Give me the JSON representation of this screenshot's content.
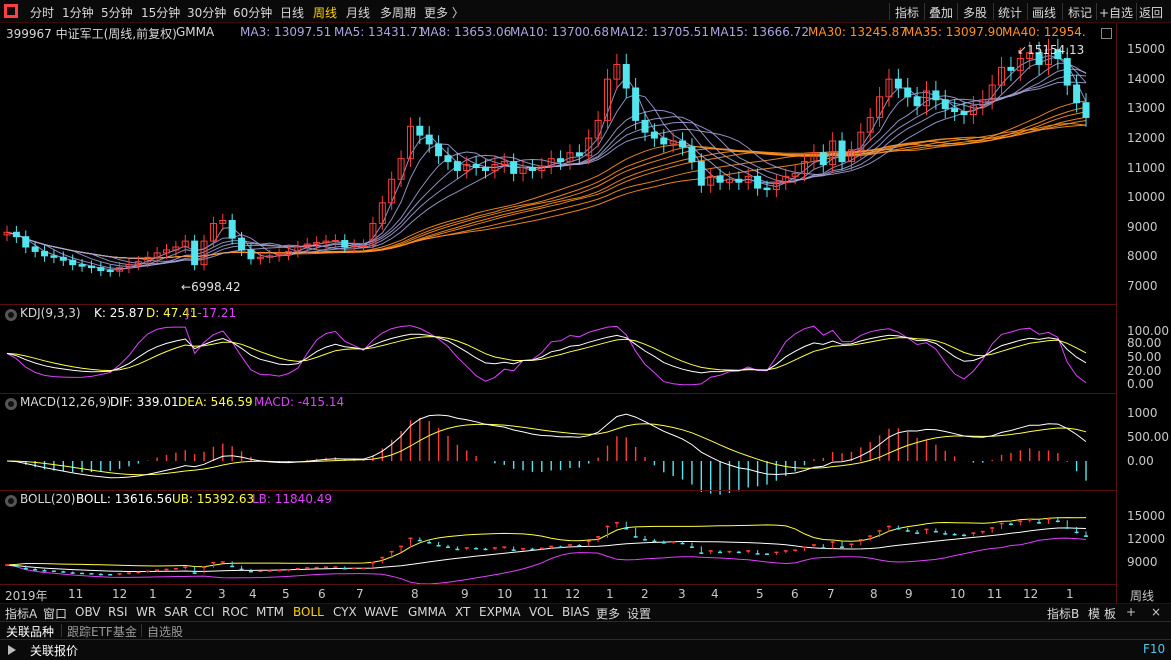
{
  "timeframes": [
    "分时",
    "1分钟",
    "5分钟",
    "15分钟",
    "30分钟",
    "60分钟",
    "日线",
    "周线",
    "月线",
    "多周期",
    "更多 〉"
  ],
  "active_timeframe": "周线",
  "toolbar": [
    "指标",
    "叠加",
    "多股",
    "统计",
    "画线",
    "标记",
    "+自选",
    "返回"
  ],
  "main": {
    "symbol": "399967 中证军工(周线,前复权)",
    "indicator": "GMMA",
    "ma_short": [
      "MA3: 13097.51",
      "MA5: 13431.71",
      "MA8: 13653.06",
      "MA10: 13700.68",
      "MA12: 13705.51",
      "MA15: 13666.72"
    ],
    "ma_long": [
      "MA30: 13245.87",
      "MA35: 13097.90",
      "MA40: 12954."
    ],
    "high_label": "15154.13",
    "low_label": "6998.42",
    "y_ticks": [
      "15000",
      "14000",
      "13000",
      "12000",
      "11000",
      "10000",
      "9000",
      "8000",
      "7000"
    ]
  },
  "kdj": {
    "name": "KDJ(9,3,3)",
    "k": "K: 25.87",
    "d": "D: 47.41",
    "j": "J: -17.21",
    "y_ticks": [
      "100.00",
      "80.00",
      "50.00",
      "20.00",
      "0.00"
    ]
  },
  "macd": {
    "name": "MACD(12,26,9)",
    "dif": "DIF: 339.01",
    "dea": "DEA: 546.59",
    "macd": "MACD: -415.14",
    "y_ticks": [
      "1000",
      "500.00",
      "0.00"
    ]
  },
  "boll": {
    "name": "BOLL(20)",
    "boll": "BOLL: 13616.56",
    "ub": "UB: 15392.63",
    "lb": "LB: 11840.49",
    "y_ticks": [
      "15000",
      "12000",
      "9000"
    ]
  },
  "x_labels": [
    "2019年",
    "11",
    "12",
    "1",
    "2",
    "3",
    "4",
    "5",
    "6",
    "7",
    "8",
    "9",
    "10",
    "11",
    "12",
    "1",
    "2",
    "3",
    "4",
    "5",
    "6",
    "7",
    "8",
    "9",
    "10",
    "11",
    "12",
    "1"
  ],
  "period_label": "周线",
  "indicators": [
    "指标A",
    "窗口",
    "OBV",
    "RSI",
    "WR",
    "SAR",
    "CCI",
    "ROC",
    "MTM",
    "BOLL",
    "CYX",
    "WAVE",
    "GMMA",
    "XT",
    "EXPMA",
    "VOL",
    "BIAS",
    "更多",
    "设置"
  ],
  "active_indicator": "BOLL",
  "indicator_right": [
    "指标B",
    "模",
    "板"
  ],
  "tabs": [
    "关联品种",
    "跟踪ETF基金",
    "自选股"
  ],
  "status_text": "关联报价",
  "status_key": "F10",
  "colors": {
    "up": "#ff3c3c",
    "down": "#54e4ee",
    "ma_short": "#a8a8e0",
    "ma_long": "#ff9020",
    "k": "#ffffff",
    "d": "#ffff40",
    "j": "#e040ff",
    "ub": "#ffff40",
    "lb": "#e040ff",
    "accent": "#ffd200"
  },
  "chart_data": {
    "type": "candlestick",
    "title": "399967 中证军工(周线,前复权)",
    "ylim": [
      6500,
      15500
    ],
    "close": [
      8800,
      8650,
      8300,
      8150,
      8000,
      7950,
      7850,
      7700,
      7650,
      7600,
      7500,
      7480,
      7600,
      7700,
      7800,
      7950,
      8100,
      8200,
      8300,
      8500,
      7700,
      8500,
      9100,
      9200,
      8600,
      8200,
      7900,
      7950,
      8000,
      8050,
      8150,
      8300,
      8400,
      8450,
      8500,
      8520,
      8300,
      8350,
      8350,
      9100,
      9800,
      10600,
      11300,
      12400,
      12100,
      11800,
      11400,
      11200,
      10900,
      11100,
      11000,
      10900,
      11100,
      11200,
      10800,
      11000,
      10900,
      11050,
      11300,
      11200,
      11500,
      11400,
      12000,
      12600,
      14000,
      14500,
      13700,
      12600,
      12200,
      12000,
      11800,
      11900,
      11700,
      11200,
      10400,
      10700,
      10500,
      10600,
      10500,
      10700,
      10300,
      10250,
      10500,
      10700,
      10800,
      11200,
      11500,
      11100,
      11900,
      11200,
      11600,
      12200,
      12700,
      13400,
      14000,
      13700,
      13400,
      13100,
      13600,
      13300,
      13000,
      12900,
      12800,
      13100,
      13300,
      13800,
      14400,
      14300,
      14700,
      14900,
      14500,
      15000,
      14700,
      13800,
      13200,
      12700
    ]
  }
}
